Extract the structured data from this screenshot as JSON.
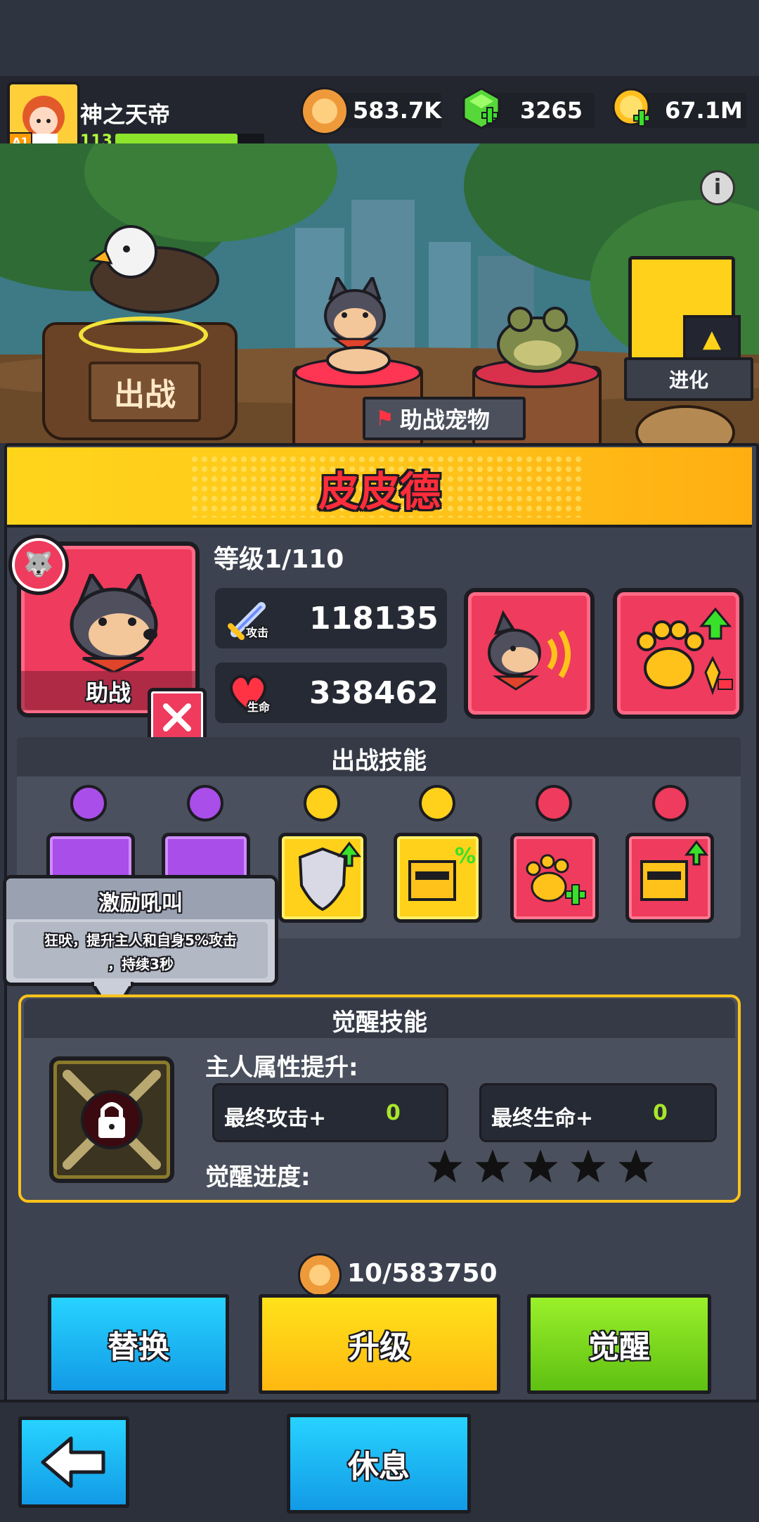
{
  "player": {
    "name": "神之天帝",
    "level": "113",
    "rank": "A1"
  },
  "resources": {
    "lion_coins": "583.7K",
    "gems": "3265",
    "gold": "67.1M"
  },
  "scene": {
    "battle_label": "出战",
    "evolve_label": "进化",
    "assist_pets_label": "助战宠物"
  },
  "pet": {
    "name": "皮皮德",
    "level_text": "等级1/110",
    "role_label": "助战",
    "attack_icon_label": "攻击",
    "attack": "118135",
    "hp_icon_label": "生命",
    "hp": "338462"
  },
  "battle_skills": {
    "title": "出战技能"
  },
  "tooltip": {
    "title": "激励吼叫",
    "desc_line1": "狂吠，提升主人和自身5%攻击",
    "desc_line2": "，持续3秒"
  },
  "awaken": {
    "title": "觉醒技能",
    "owner_boost": "主人属性提升:",
    "final_attack_label": "最终攻击+",
    "final_attack_value": "0",
    "final_hp_label": "最终生命+",
    "final_hp_value": "0",
    "progress_label": "觉醒进度:",
    "stars": 5
  },
  "upgrade_cost": "10/583750",
  "buttons": {
    "replace": "替换",
    "upgrade": "升级",
    "awaken": "觉醒",
    "rest": "休息"
  },
  "colors": {
    "accent_yellow": "#ffd11a",
    "accent_red": "#ef3b5d",
    "button_blue": "#19b6f0",
    "button_green": "#77d615"
  }
}
